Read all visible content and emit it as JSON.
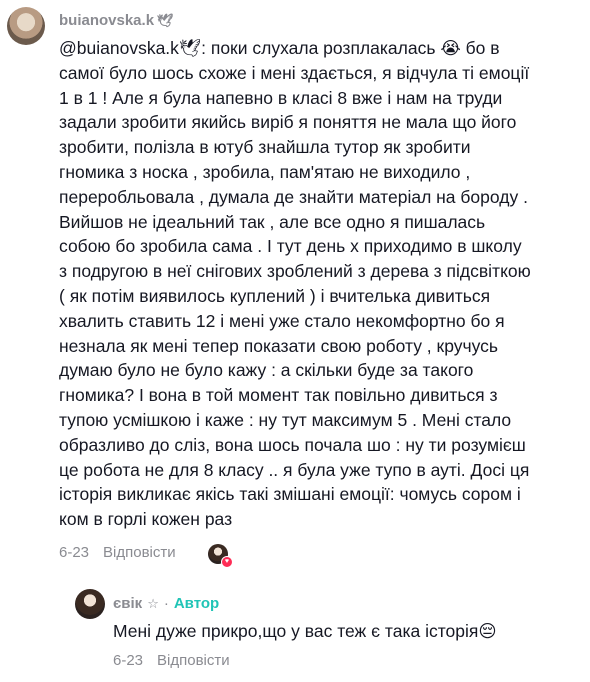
{
  "comment": {
    "username": "buianovska.k",
    "username_emoji": "🕊",
    "text": "@buianovska.k🕊: поки слухала розплакалась 😭 бо в\nсамої було шось схоже і мені здається, я відчула ті емоції\n1 в 1 ! Але я була напевно в класі 8 вже і нам на труди\nзадали зробити якийсь виріб я поняття не мала що його\nзробити, полізла в ютуб знайшла тутор як зробити\nгномика з носка , зробила, пам'ятаю не виходило ,\nпереробльовала , думала де знайти матеріал на бороду .\nВийшов не ідеальний так , але все одно я пишалась\nсобою бо зробила сама . І тут день х приходимо в школу\nз подругою в неї снігових зроблений з дерева з підсвіткою\n( як потім виявилось куплений ) і вчителька дивиться\nхвалить ставить 12 і мені уже стало некомфортно бо я\nнезнала як мені тепер показати свою роботу , кручусь\nдумаю було не було кажу : а скільки буде за такого\nгномика? І вона в той момент так повільно дивиться з\nтупою усмішкою і каже : ну тут максимум 5 . Мені стало\nобразливо до сліз, вона шось почала шо : ну ти розумієш\nце робота не для 8 класу .. я була уже тупо в ауті. Досі ця\nісторія викликає якісь такі змішані емоції: чомусь сором і\nком в горлі кожен раз",
    "date": "6-23",
    "reply_label": "Відповісти"
  },
  "reply": {
    "username": "євік",
    "star": "☆",
    "separator": "·",
    "author_badge": "Автор",
    "text": "Мені дуже прикро,що у вас теж є така історія😔",
    "date": "6-23",
    "reply_label": "Відповісти"
  },
  "colors": {
    "author_badge": "#20c4b6",
    "secondary_text": "#8a8b91",
    "like_heart": "#fe2c55"
  }
}
